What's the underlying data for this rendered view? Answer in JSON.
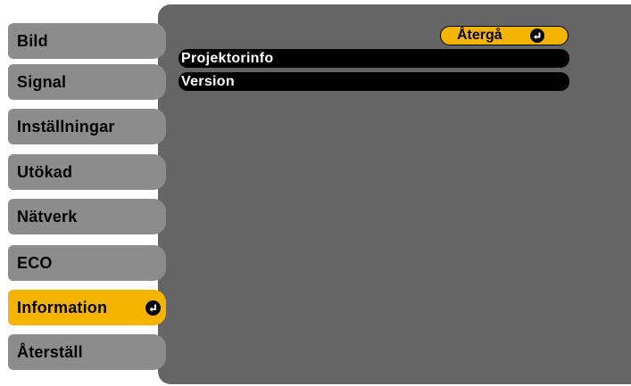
{
  "sidebar": {
    "items": [
      {
        "label": "Bild"
      },
      {
        "label": "Signal"
      },
      {
        "label": "Inställningar"
      },
      {
        "label": "Utökad"
      },
      {
        "label": "Nätverk"
      },
      {
        "label": "ECO"
      },
      {
        "label": "Information",
        "selected": true,
        "icon": "enter-icon"
      },
      {
        "label": "Återställ"
      }
    ]
  },
  "main": {
    "back_button": {
      "label": "Återgå",
      "icon": "enter-icon"
    },
    "items": [
      {
        "label": "Projektorinfo"
      },
      {
        "label": "Version"
      }
    ]
  },
  "colors": {
    "accent": "#f5b400",
    "tab_background": "#8c8c8c",
    "panel_background": "#656565",
    "item_background": "#000000",
    "item_text": "#ffffff"
  }
}
